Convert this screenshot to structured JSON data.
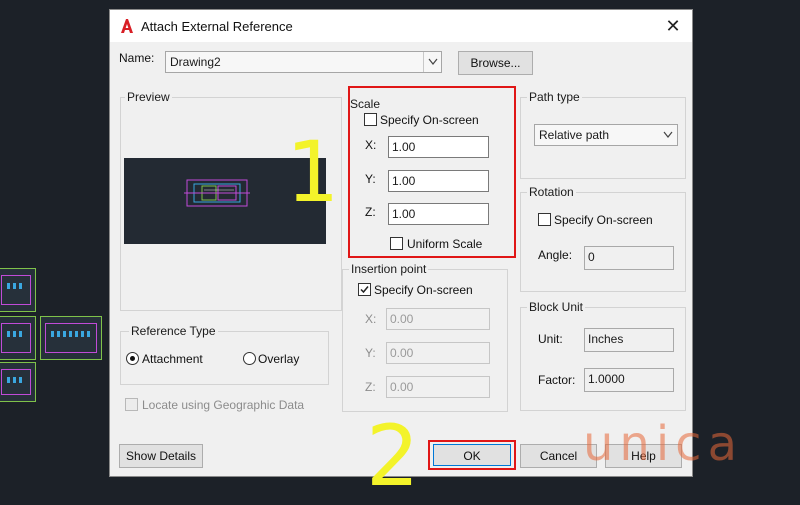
{
  "window": {
    "title": "Attach External Reference",
    "close_glyph": "✕"
  },
  "name_field": {
    "label": "Name:",
    "value": "Drawing2",
    "browse_label": "Browse..."
  },
  "preview": {
    "label": "Preview"
  },
  "reference_type": {
    "label": "Reference Type",
    "options": [
      "Attachment",
      "Overlay"
    ],
    "selected": "Attachment"
  },
  "geo": {
    "label": "Locate using Geographic Data",
    "checked": false
  },
  "scale": {
    "label": "Scale",
    "specify_on_screen_label": "Specify On-screen",
    "specify_on_screen_checked": false,
    "x_label": "X:",
    "x_value": "1.00",
    "y_label": "Y:",
    "y_value": "1.00",
    "z_label": "Z:",
    "z_value": "1.00",
    "uniform_scale_label": "Uniform Scale",
    "uniform_scale_checked": false
  },
  "insertion_point": {
    "label": "Insertion point",
    "specify_on_screen_label": "Specify On-screen",
    "specify_on_screen_checked": true,
    "x_label": "X:",
    "x_value": "0.00",
    "y_label": "Y:",
    "y_value": "0.00",
    "z_label": "Z:",
    "z_value": "0.00"
  },
  "path_type": {
    "label": "Path type",
    "value": "Relative path"
  },
  "rotation": {
    "label": "Rotation",
    "specify_on_screen_label": "Specify On-screen",
    "angle_label": "Angle:",
    "angle_value": "0"
  },
  "block_unit": {
    "label": "Block Unit",
    "unit_label": "Unit:",
    "unit_value": "Inches",
    "factor_label": "Factor:",
    "factor_value": "1.0000"
  },
  "buttons": {
    "show_details": "Show Details",
    "ok": "OK",
    "cancel": "Cancel",
    "help": "Help"
  },
  "annotations": {
    "step1": "1",
    "step2": "2",
    "highlight_color": "#e01616",
    "number_color": "#f3f32a"
  },
  "watermark": "unica",
  "colors": {
    "accent_red": "#e01616",
    "dialog_bg": "#f0f0f0",
    "background": "#1c2128"
  }
}
